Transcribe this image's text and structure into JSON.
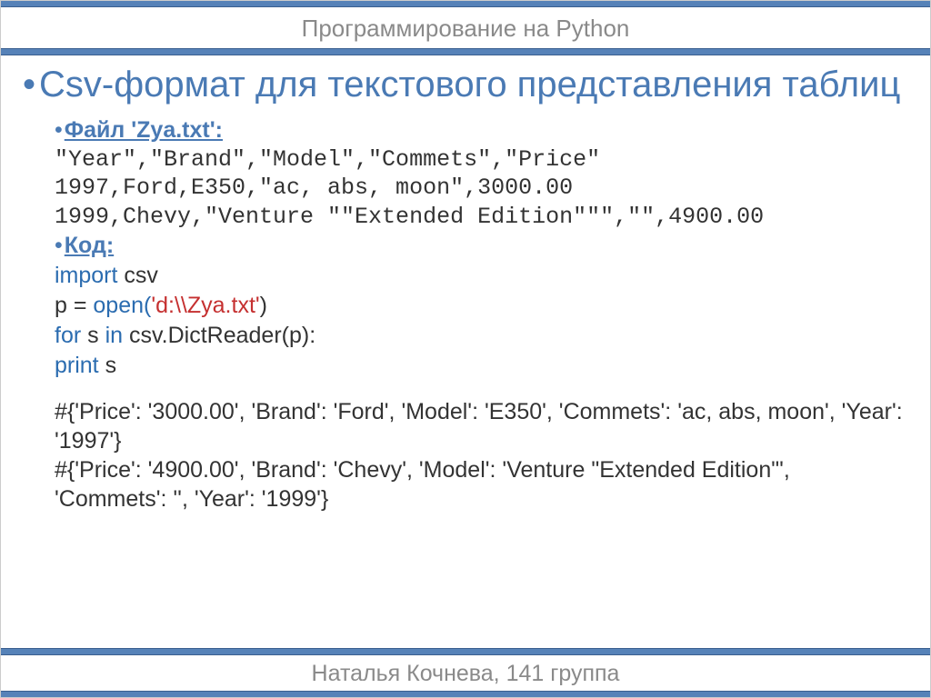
{
  "header": {
    "title": "Программирование на Python"
  },
  "footer": {
    "text": "Наталья Кочнева, 141 группа"
  },
  "slide": {
    "title": "Csv-формат для текстового представления таблиц",
    "file_label": "Файл 'Zya.txt':",
    "file_line1": "\"Year\",\"Brand\",\"Model\",\"Commets\",\"Price\"",
    "file_line2": "1997,Ford,E350,\"ac, abs, moon\",3000.00",
    "file_line3": "1999,Chevy,\"Venture \"\"Extended Edition\"\"\",\"\",4900.00",
    "code_label": "Код:",
    "code": {
      "import_kw": "import",
      "import_mod": "csv",
      "assign_left": "p = ",
      "open_fn": "open(",
      "open_arg": "'d:\\\\Zya.txt'",
      "open_close": ")",
      "for_kw": "for",
      "for_var": " s ",
      "in_kw": "in",
      "dictreader": " csv.DictReader(p):",
      "indent": "    ",
      "print_kw": "print",
      "print_arg": " s"
    },
    "output_line1": "#{'Price': '3000.00', 'Brand': 'Ford', 'Model': 'E350', 'Commets': 'ac, abs, moon', 'Year': '1997'}",
    "output_line2": "#{'Price': '4900.00', 'Brand': 'Chevy', 'Model': 'Venture \"Extended Edition\"', 'Commets': '', 'Year': '1999'}"
  }
}
